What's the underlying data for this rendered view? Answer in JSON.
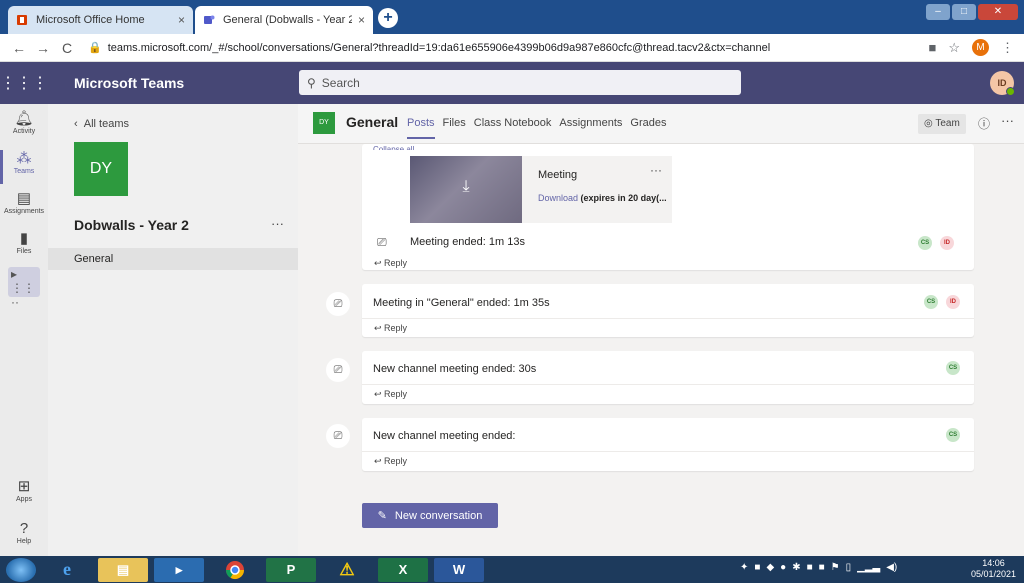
{
  "browser": {
    "tabs": [
      {
        "title": "Microsoft Office Home",
        "close": "×"
      },
      {
        "title": "General (Dobwalls - Year 2) | Mic",
        "close": "×"
      }
    ],
    "new_tab": "+",
    "url": "teams.microsoft.com/_#/school/conversations/General?threadId=19:da61e655906e4399b06d9a987e860cfc@thread.tacv2&ctx=channel",
    "profile_initial": "M",
    "back": "←",
    "forward": "→",
    "reload": "C"
  },
  "teams": {
    "app_title": "Microsoft Teams",
    "search_placeholder": "Search",
    "user_initials": "ID"
  },
  "rail": [
    {
      "label": "Activity",
      "icon": "bell-icon"
    },
    {
      "label": "Teams",
      "icon": "teams-icon"
    },
    {
      "label": "Assignments",
      "icon": "assignments-icon"
    },
    {
      "label": "Files",
      "icon": "files-icon"
    },
    {
      "label": "Apps",
      "icon": "apps-icon"
    },
    {
      "label": "Help",
      "icon": "help-icon"
    }
  ],
  "team_panel": {
    "back_label": "All teams",
    "tile": "DY",
    "team_name": "Dobwalls - Year 2",
    "more": "···",
    "channels": [
      "General"
    ]
  },
  "channel": {
    "tile": "DY",
    "name": "General",
    "tabs": [
      "Posts",
      "Files",
      "Class Notebook",
      "Assignments",
      "Grades"
    ],
    "team_button": "Team",
    "more": "···"
  },
  "feed": {
    "collapse_label": "Collapse all",
    "recording": {
      "title": "Meeting",
      "more": "···",
      "download": "Download",
      "expires": "(expires in 20 day(..."
    },
    "events": [
      {
        "text": "Meeting ended: 1m 13s",
        "participants": [
          "CS",
          "ID"
        ]
      },
      {
        "text": "Meeting in \"General\" ended: 1m 35s",
        "participants": [
          "CS",
          "ID"
        ]
      },
      {
        "text": "New channel meeting ended: 30s",
        "participants": [
          "CS"
        ]
      },
      {
        "text": "New channel meeting ended:",
        "participants": [
          "CS"
        ]
      }
    ],
    "reply_label": "Reply",
    "new_conversation": "New conversation"
  },
  "taskbar": {
    "time": "14:06",
    "date": "05/01/2021"
  },
  "colors": {
    "teams_purple": "#464775",
    "accent": "#6264a7",
    "team_tile": "#2d9a3e"
  }
}
